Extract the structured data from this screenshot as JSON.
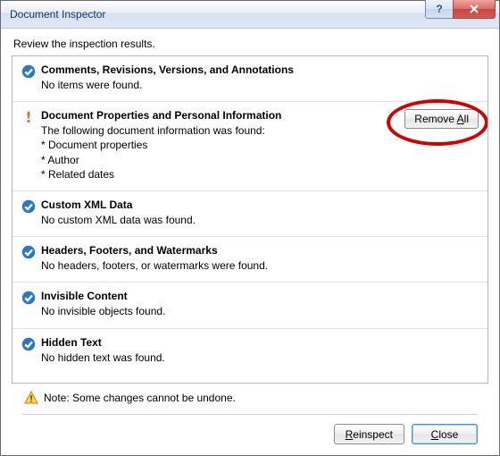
{
  "title": "Document Inspector",
  "instruction": "Review the inspection results.",
  "sections": [
    {
      "title": "Comments, Revisions, Versions, and Annotations",
      "text": "No items were found."
    },
    {
      "title": "Document Properties and Personal Information",
      "text": "The following document information was found:\n* Document properties\n* Author\n* Related dates"
    },
    {
      "title": "Custom XML Data",
      "text": "No custom XML data was found."
    },
    {
      "title": "Headers, Footers, and Watermarks",
      "text": "No headers, footers, or watermarks were found."
    },
    {
      "title": "Invisible Content",
      "text": "No invisible objects found."
    },
    {
      "title": "Hidden Text",
      "text": "No hidden text was found."
    }
  ],
  "remove_all_prefix": "Remove ",
  "remove_all_accel": "A",
  "remove_all_suffix": "ll",
  "note": "Note: Some changes cannot be undone.",
  "reinspect_prefix": "",
  "reinspect_accel": "R",
  "reinspect_suffix": "einspect",
  "close_prefix": "",
  "close_accel": "C",
  "close_suffix": "lose"
}
